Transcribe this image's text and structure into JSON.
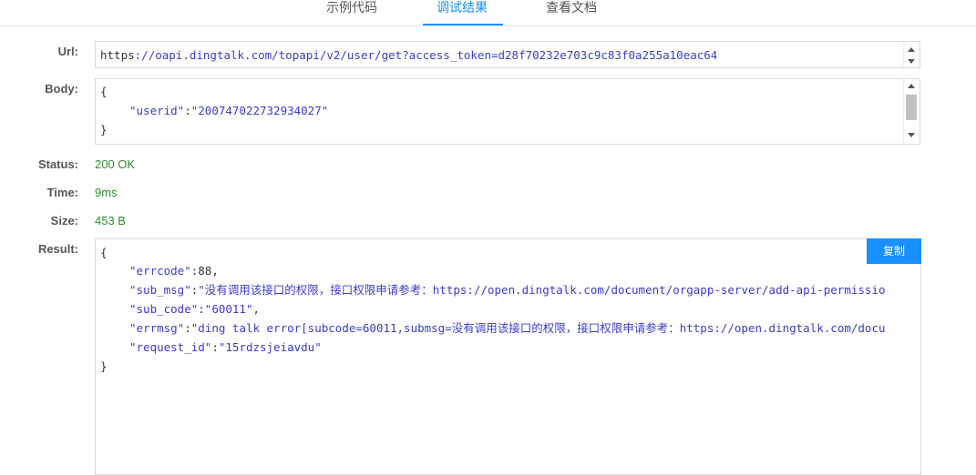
{
  "tabs": [
    {
      "label": "示例代码",
      "active": false
    },
    {
      "label": "调试结果",
      "active": true
    },
    {
      "label": "查看文档",
      "active": false
    }
  ],
  "url": {
    "label": "Url:",
    "scheme": "https",
    "rest": "://oapi.dingtalk.com/topapi/v2/user/get?access_token=d28f70232e703c9c83f0a255a10eac64"
  },
  "body": {
    "label": "Body:",
    "lines": [
      "{",
      "\"userid\":\"200747022732934027\"",
      "}"
    ],
    "key": "\"userid\"",
    "sep": ":",
    "val": "\"200747022732934027\""
  },
  "status": {
    "label": "Status:",
    "value": "200 OK"
  },
  "time": {
    "label": "Time:",
    "value": "9ms"
  },
  "size": {
    "label": "Size:",
    "value": "453 B"
  },
  "result": {
    "label": "Result:",
    "copy_label": "复制",
    "open": "{",
    "close": "}",
    "rows": [
      {
        "key": "\"errcode\"",
        "val": "88",
        "tail": ","
      },
      {
        "key": "\"sub_msg\"",
        "val": "\"没有调用该接口的权限，接口权限申请参考：https://open.dingtalk.com/document/orgapp-server/add-api-permissio",
        "tail": ""
      },
      {
        "key": "\"sub_code\"",
        "val": "\"60011\"",
        "tail": ","
      },
      {
        "key": "\"errmsg\"",
        "val": "\"ding talk error[subcode=60011,submsg=没有调用该接口的权限，接口权限申请参考：https://open.dingtalk.com/docu",
        "tail": ""
      },
      {
        "key": "\"request_id\"",
        "val": "\"15rdzsjeiavdu\"",
        "tail": ""
      }
    ]
  },
  "colors": {
    "accent": "#1890ff",
    "ok": "#2e8b2e",
    "json_string": "#3b3bcc"
  }
}
